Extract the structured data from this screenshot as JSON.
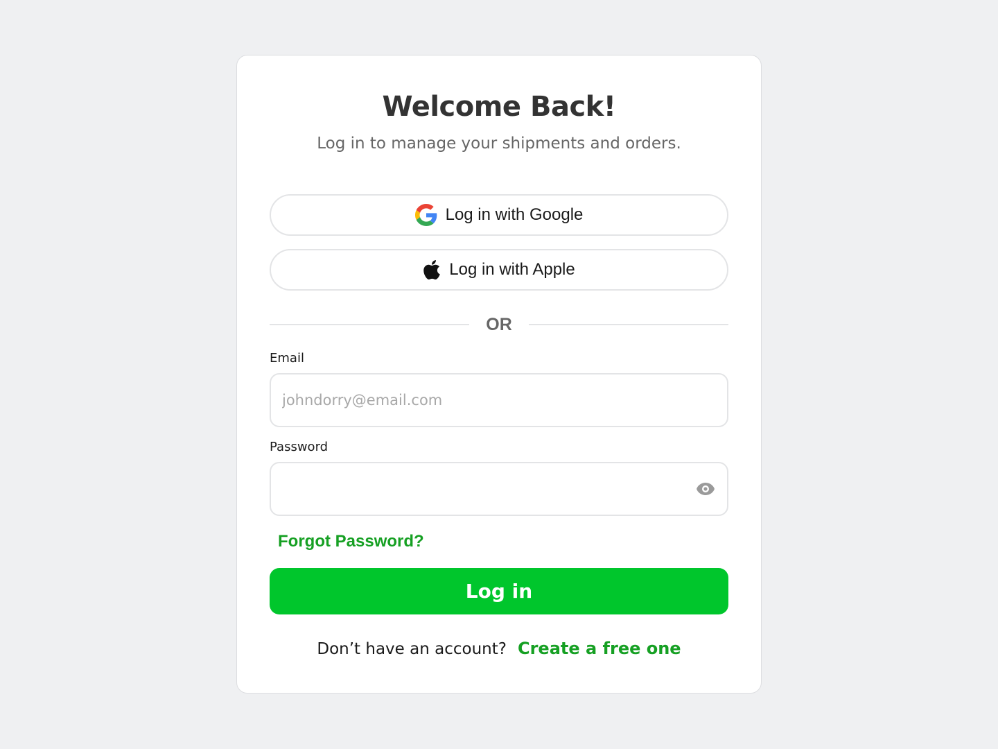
{
  "header": {
    "title": "Welcome Back!",
    "subtitle": "Log in to manage your shipments and orders."
  },
  "social": {
    "google_label": "Log in with Google",
    "apple_label": "Log in with Apple",
    "google_icon": "google-g-icon",
    "apple_icon": "apple-logo-icon"
  },
  "divider": {
    "label": "OR"
  },
  "form": {
    "email": {
      "label": "Email",
      "placeholder": "johndorry@email.com",
      "value": ""
    },
    "password": {
      "label": "Password",
      "value": "",
      "toggle_icon": "eye-icon"
    },
    "forgot_label": "Forgot Password?",
    "submit_label": "Log in"
  },
  "footer": {
    "prompt": "Don’t have an account?",
    "signup_label": "Create a free one"
  },
  "colors": {
    "accent": "#00c62c",
    "link": "#16a023",
    "background": "#eff0f2",
    "card": "#ffffff"
  }
}
